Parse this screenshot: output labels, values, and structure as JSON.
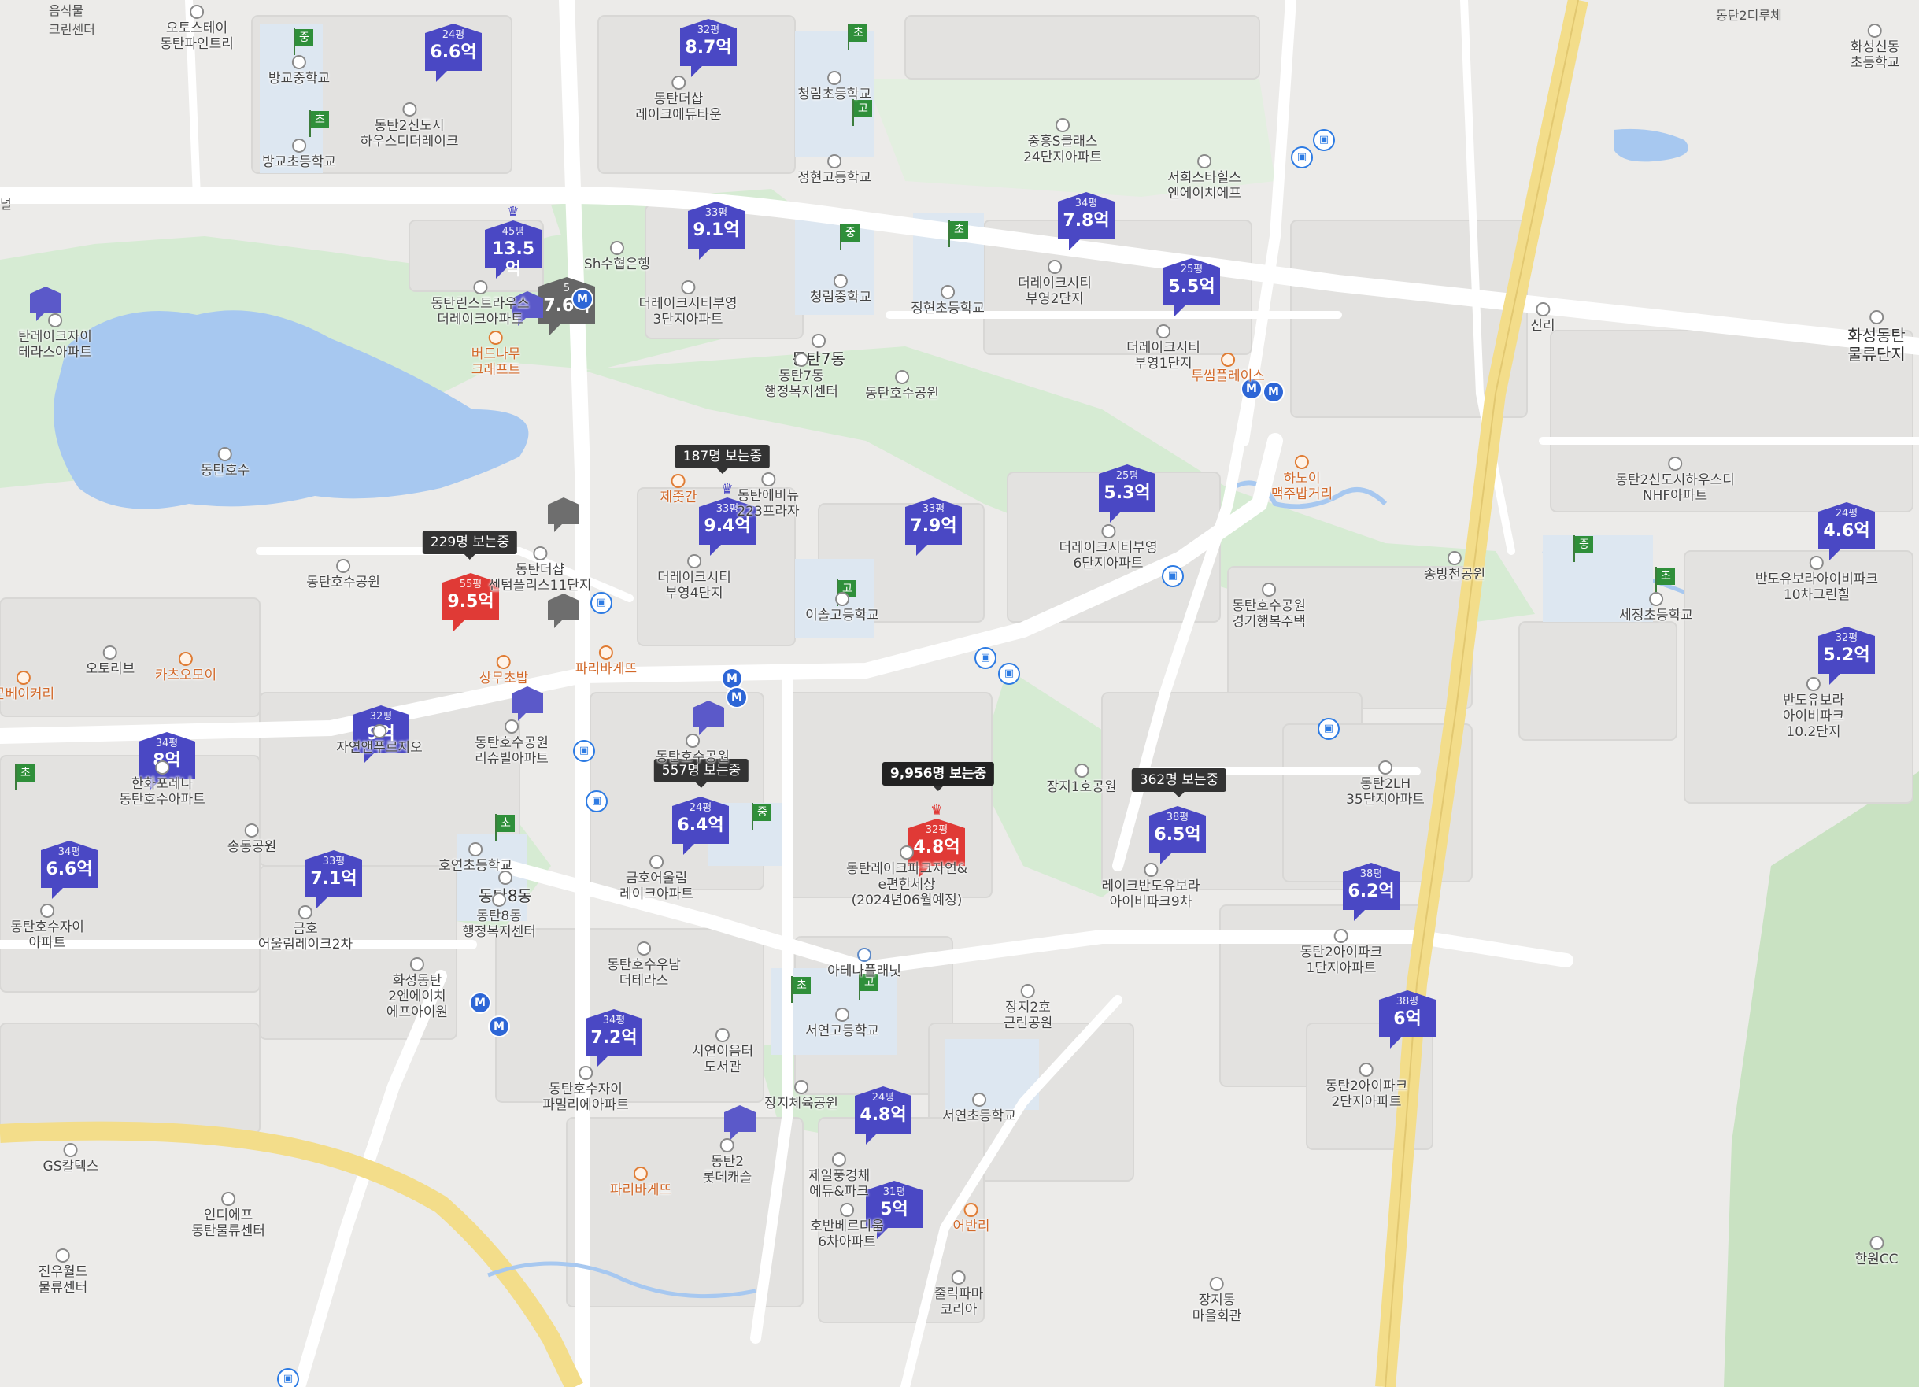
{
  "map": {
    "edge_labels": {
      "left_top": "음식물\n크린센터",
      "left_road": "널",
      "top_right": "동탄2디루체"
    },
    "icons": {
      "school_flag": "school-flag-icon",
      "metro": "metro-icon",
      "bus": "bus-stop-icon",
      "poi": "poi-pin-icon",
      "crown": "crown-icon"
    },
    "colors": {
      "price_marker": "#4a48c4",
      "hot_marker": "#e03a36",
      "inactive_marker": "#666666",
      "water": "#a7c8f0",
      "park": "#d4ead1",
      "expressway": "#f3dd8a"
    },
    "price_markers": [
      {
        "pyeong": "24평",
        "price": "6.6억",
        "color": "blue"
      },
      {
        "pyeong": "32평",
        "price": "8.7억",
        "color": "blue"
      },
      {
        "pyeong": "45평",
        "price": "13.5억",
        "color": "blue",
        "crown": true
      },
      {
        "pyeong": "33평",
        "price": "9.1억",
        "color": "blue"
      },
      {
        "pyeong": "5",
        "price": "7.6억",
        "color": "gray"
      },
      {
        "pyeong": "34평",
        "price": "7.8억",
        "color": "blue"
      },
      {
        "pyeong": "25평",
        "price": "5.5억",
        "color": "blue"
      },
      {
        "pyeong": "33평",
        "price": "9.4억",
        "color": "blue",
        "crown": true
      },
      {
        "pyeong": "33평",
        "price": "7.9억",
        "color": "blue"
      },
      {
        "pyeong": "25평",
        "price": "5.3억",
        "color": "blue"
      },
      {
        "pyeong": "55평",
        "price": "9.5억",
        "color": "red"
      },
      {
        "pyeong": "24평",
        "price": "4.6억",
        "color": "blue"
      },
      {
        "pyeong": "32평",
        "price": "5.2억",
        "color": "blue"
      },
      {
        "pyeong": "32평",
        "price": "9억",
        "color": "blue"
      },
      {
        "pyeong": "34평",
        "price": "8억",
        "color": "blue"
      },
      {
        "pyeong": "24평",
        "price": "6.4억",
        "color": "blue"
      },
      {
        "pyeong": "32평",
        "price": "4.8억",
        "color": "red",
        "crown": true
      },
      {
        "pyeong": "38평",
        "price": "6.5억",
        "color": "blue"
      },
      {
        "pyeong": "34평",
        "price": "6.6억",
        "color": "blue"
      },
      {
        "pyeong": "33평",
        "price": "7.1억",
        "color": "blue"
      },
      {
        "pyeong": "38평",
        "price": "6.2억",
        "color": "blue"
      },
      {
        "pyeong": "34평",
        "price": "7.2억",
        "color": "blue"
      },
      {
        "pyeong": "38평",
        "price": "6억",
        "color": "blue"
      },
      {
        "pyeong": "24평",
        "price": "4.8억",
        "color": "blue"
      },
      {
        "pyeong": "31평",
        "price": "5억",
        "color": "blue"
      }
    ],
    "viewers": [
      "187명 보는중",
      "229명 보는중",
      "557명 보는중",
      "9,956명 보는중",
      "362명 보는중"
    ],
    "school_flags": [
      "중",
      "초",
      "초",
      "고",
      "중",
      "초",
      "고",
      "중",
      "초",
      "초",
      "초",
      "중",
      "고",
      "초"
    ],
    "labels": [
      "오토스테이\n동탄파인트리",
      "방교중학교",
      "방교초등학교",
      "동탄2신도시\n하우스디더레이크",
      "동탄더샵\n레이크에듀타운",
      "청림초등학교",
      "정현고등학교",
      "중흥S클래스\n24단지아파트",
      "서희스타힐스\n엔에이치에프",
      "Sh수협은행",
      "동탄린스트라우스\n더레이크아파트",
      "더레이크시티부영\n3단지아파트",
      "청림중학교",
      "정현초등학교",
      "더레이크시티\n부영2단지",
      "더레이크시티\n부영1단지",
      "신리",
      "화성동탄\n물류단지",
      "탄레이크자이\n테라스아파트",
      "버드나무\n크래프트",
      "동탄7동",
      "동탄7동\n행정복지센터",
      "동탄호수공원",
      "투썸플레이스",
      "동탄호수",
      "하노이\n맥주밥거리",
      "동탄2신도시하우스디\nNHF아파트",
      "제줏간",
      "동탄에비뉴\n223프라자",
      "더레이크시티\n부영4단지",
      "더레이크시티부영\n6단지아파트",
      "동탄더샵\n센텀폴리스11단지",
      "동탄호수공원",
      "송방천공원",
      "동탄호수공원\n경기행복주택",
      "이솔고등학교",
      "반도유보라아이비파크\n10차그린힐",
      "세정초등학교",
      "반도유보라\n아이비파크\n10.2단지",
      "오토리브",
      "카츠오모이",
      "상무초밥",
      "파리바게뜨",
      "근베이커리",
      "자연앤푸르지오",
      "동탄호수공원\n리슈빌아파트",
      "동탄호수공원",
      "한화포레나\n동탄호수아파트",
      "장지1호공원",
      "동탄2LH\n35단지아파트",
      "송동공원",
      "금호어울림\n레이크아파트",
      "동탄레이크파크자연&\ne편한세상\n(2024년06월예정)",
      "레이크반도유보라\n아이비파크9차",
      "호연초등학교",
      "동탄8동",
      "동탄8동\n행정복지센터",
      "동탄호수자이\n아파트",
      "금호\n어울림레이크2차",
      "동탄호수우남\n더테라스",
      "아테나플래닛",
      "동탄2아이파크\n1단지아파트",
      "화성동탄\n2엔에이치\n에프아이원",
      "서연고등학교",
      "장지2호\n근린공원",
      "서연이음터\n도서관",
      "동탄호수자이\n파밀리에아파트",
      "장지체육공원",
      "서연초등학교",
      "동탄2아이파크\n2단지아파트",
      "동탄2\n롯데캐슬",
      "제일풍경채\n에듀&파크",
      "GS칼텍스",
      "인디에프\n동탄물류센터",
      "파리바게뜨",
      "호반베르디움\n6차아파트",
      "어반리",
      "진우월드\n물류센터",
      "줄릭파마\n코리아",
      "장지동\n마을회관",
      "화성신동\n초등학교",
      "한원CC"
    ]
  }
}
